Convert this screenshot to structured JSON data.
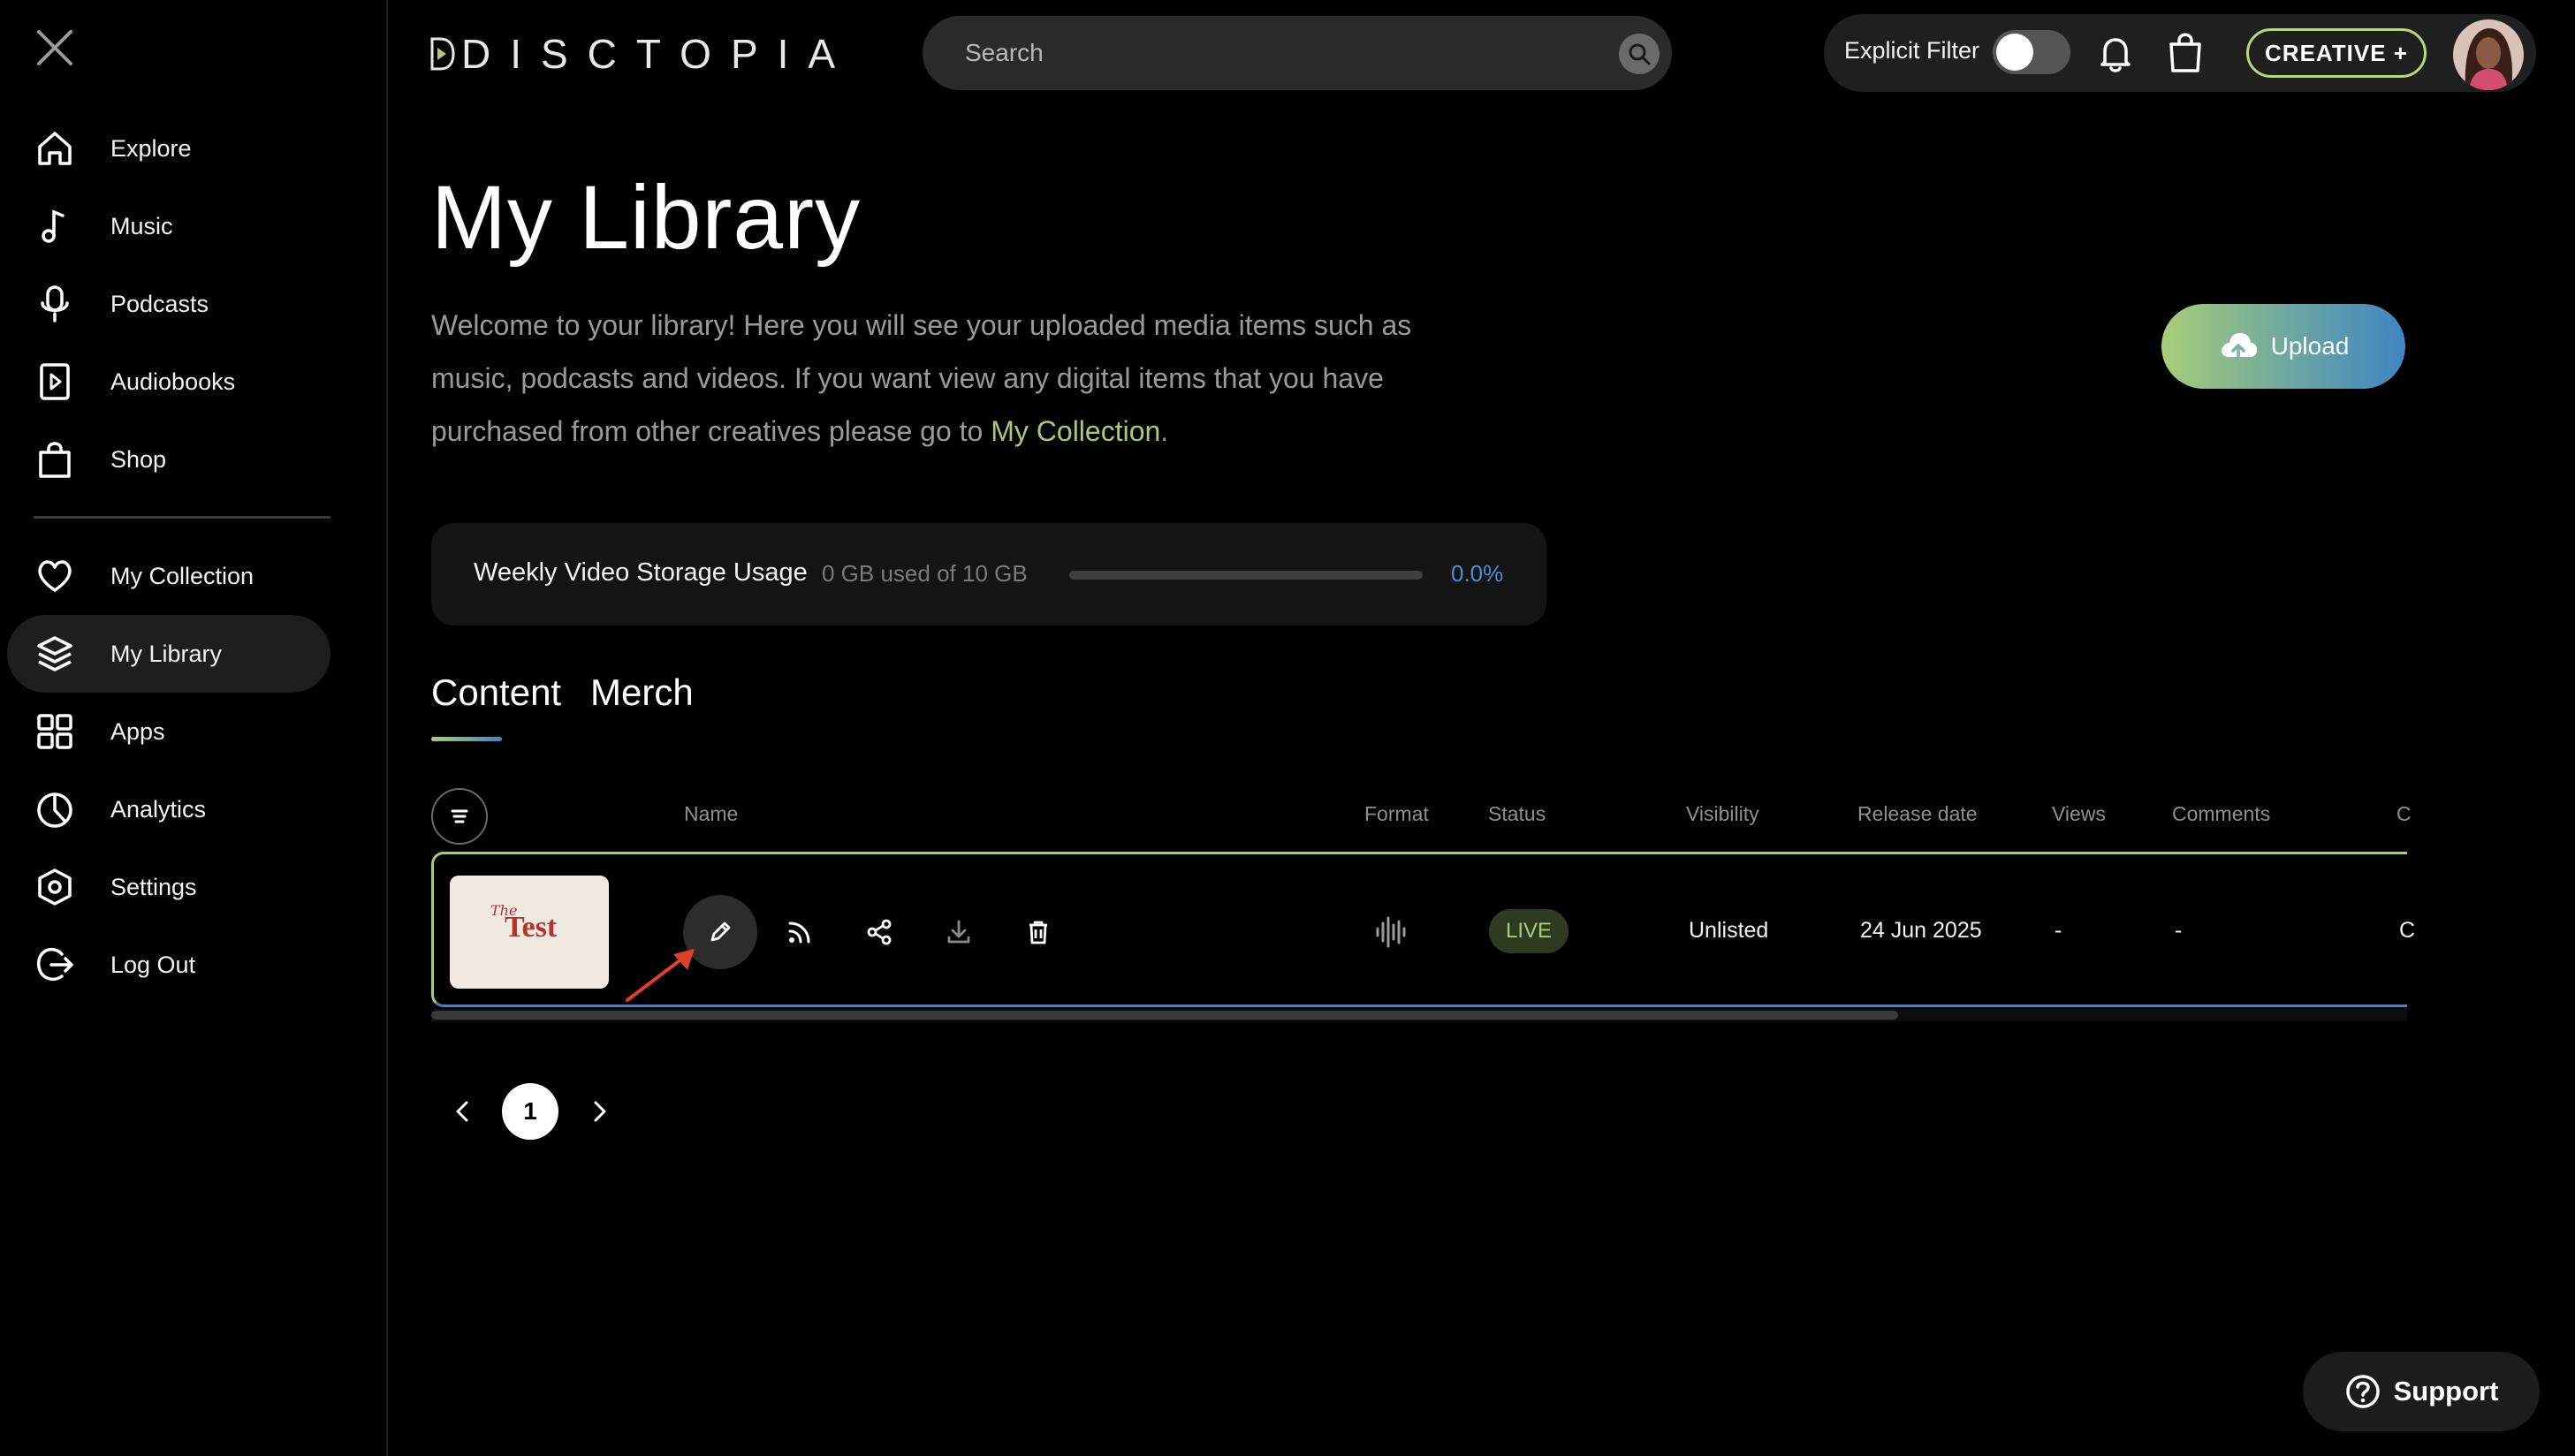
{
  "app": {
    "logo_text": "DISCTOPIA"
  },
  "sidebar": {
    "close_icon": "close-icon",
    "items": [
      {
        "label": "Explore",
        "icon": "home-icon"
      },
      {
        "label": "Music",
        "icon": "music-note-icon"
      },
      {
        "label": "Podcasts",
        "icon": "microphone-icon"
      },
      {
        "label": "Audiobooks",
        "icon": "play-book-icon"
      },
      {
        "label": "Shop",
        "icon": "shopping-bag-icon"
      },
      {
        "label": "My Collection",
        "icon": "heart-icon"
      },
      {
        "label": "My Library",
        "icon": "layers-icon",
        "active": true
      },
      {
        "label": "Apps",
        "icon": "grid-icon"
      },
      {
        "label": "Analytics",
        "icon": "pie-chart-icon"
      },
      {
        "label": "Settings",
        "icon": "settings-icon"
      },
      {
        "label": "Log Out",
        "icon": "logout-icon"
      }
    ]
  },
  "topbar": {
    "search_placeholder": "Search",
    "explicit_filter_label": "Explicit Filter",
    "explicit_filter_on": false,
    "creative_label": "CREATIVE +"
  },
  "main": {
    "title": "My Library",
    "intro_text": "Welcome to your library! Here you will see your uploaded media items such as music, podcasts and videos. If you want view any digital items that you have purchased from other creatives please go to ",
    "intro_link": "My Collection",
    "intro_end": ".",
    "upload_label": "Upload",
    "storage": {
      "label": "Weekly Video Storage Usage",
      "usage_text": "0 GB used of 10 GB",
      "percent_text": "0.0%",
      "percent_value": 0.0
    },
    "tabs": [
      {
        "label": "Content",
        "active": true
      },
      {
        "label": "Merch",
        "active": false
      }
    ]
  },
  "table": {
    "columns": [
      "Name",
      "Format",
      "Status",
      "Visibility",
      "Release date",
      "Views",
      "Comments",
      "C"
    ],
    "rows": [
      {
        "thumb_small": "The",
        "thumb_big": "Test",
        "status": "LIVE",
        "visibility": "Unlisted",
        "release_date": "24 Jun 2025",
        "views": "-",
        "comments": "-",
        "extra": "C"
      }
    ]
  },
  "pagination": {
    "current_page": "1"
  },
  "support": {
    "label": "Support"
  },
  "colors": {
    "accent_green": "#a8cd78",
    "accent_blue": "#4a8fd8",
    "background": "#000000"
  }
}
